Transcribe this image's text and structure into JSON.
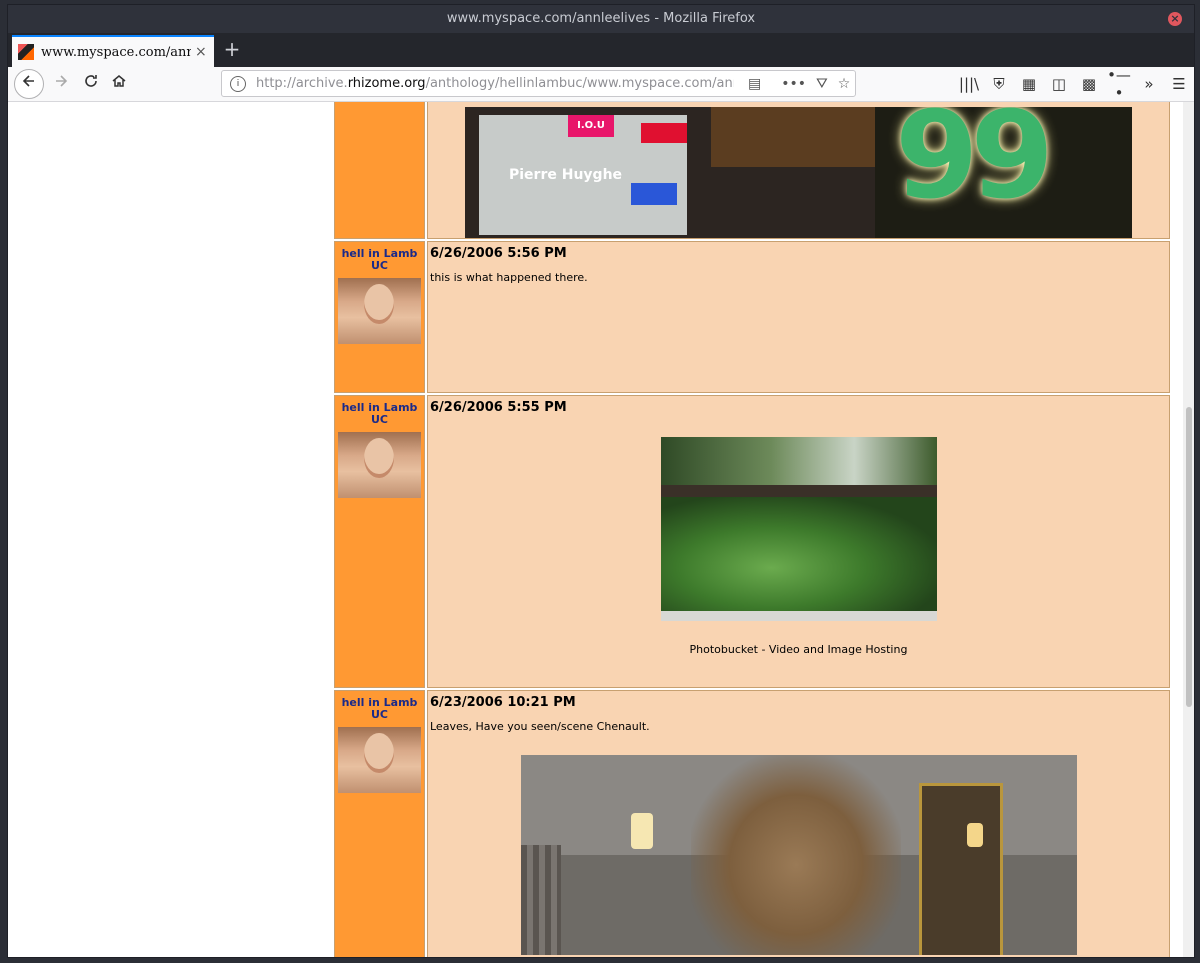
{
  "window": {
    "title": "www.myspace.com/annleelives - Mozilla Firefox",
    "close_glyph": "×"
  },
  "tab": {
    "title": "www.myspace.com/annleelives",
    "close_glyph": "×",
    "new_tab_glyph": "+"
  },
  "nav": {
    "url_prefix": "http://archive.",
    "url_host": "rhizome.org",
    "url_suffix": "/anthology/hellinlambuc/www.myspace.com/annleelives",
    "icons": [
      "back-icon",
      "forward-icon",
      "reload-icon",
      "home-icon",
      "reader-icon",
      "more-icon",
      "pocket-icon",
      "bookmark-star-icon",
      "library-icon",
      "shield-icon",
      "addon-icon",
      "sidebar-icon",
      "container-icon",
      "sync-icon",
      "overflow-icon",
      "menu-icon"
    ]
  },
  "posts": [
    {
      "author": "hell in Lamb UC",
      "datetime": "6/26/2006 5:56 PM",
      "text": "this is what happened there."
    },
    {
      "author": "hell in Lamb UC",
      "datetime": "6/26/2006 5:55 PM",
      "caption": "Photobucket - Video and Image Hosting"
    },
    {
      "author": "hell in Lamb UC",
      "datetime": "6/23/2006 10:21 PM",
      "text": "Leaves, Have you seen/scene Chenault."
    }
  ],
  "photo_top_text": {
    "iou": "I.O.U",
    "name": "Pierre Huyghe",
    "number": "99"
  }
}
